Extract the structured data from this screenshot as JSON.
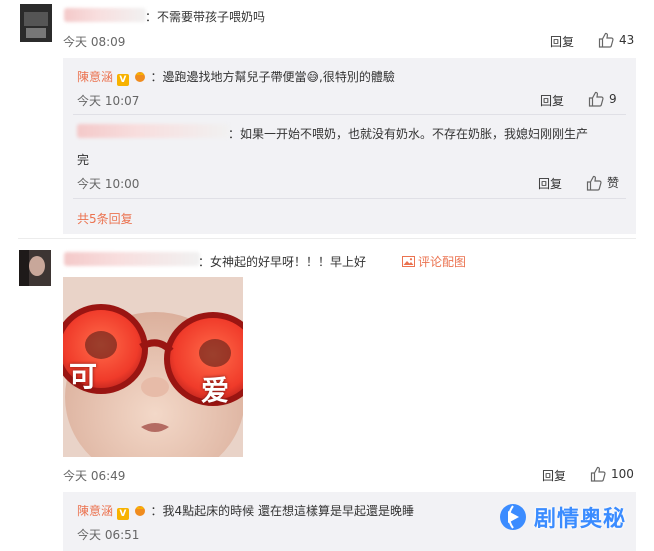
{
  "comments": [
    {
      "text": "：不需要带孩子喂奶吗",
      "time": "今天 08:09",
      "reply_label": "回复",
      "likes": "43",
      "replies": [
        {
          "author": "陳意涵",
          "text": "：邊跑邊找地方幫兒子帶便當",
          "emoji": "😅",
          "text_after": ",很特別的體驗",
          "time": "今天 10:07",
          "reply_label": "回复",
          "likes": "9"
        },
        {
          "text_line1": "：如果一开始不喂奶，也就没有奶水。不存在奶胀，我媳妇刚刚生产",
          "text_line2": "完",
          "time": "今天 10:00",
          "reply_label": "回复",
          "likes": "赞"
        }
      ],
      "more_replies": "共5条回复"
    },
    {
      "text": "：女神起的好早呀！！！早上好",
      "pic_link": "评论配图",
      "photo_caption_left": "可",
      "photo_caption_right": "爱",
      "time": "今天 06:49",
      "reply_label": "回复",
      "likes": "100",
      "replies": [
        {
          "author": "陳意涵",
          "text": "：我4點起床的時候 還在想這樣算是早起還是晚睡",
          "time": "今天 06:51"
        }
      ]
    }
  ],
  "watermark": "剧情奥秘",
  "colors": {
    "accent": "#eb7350",
    "watermark": "#3b8cff",
    "sub_bg": "#f2f2f5"
  }
}
